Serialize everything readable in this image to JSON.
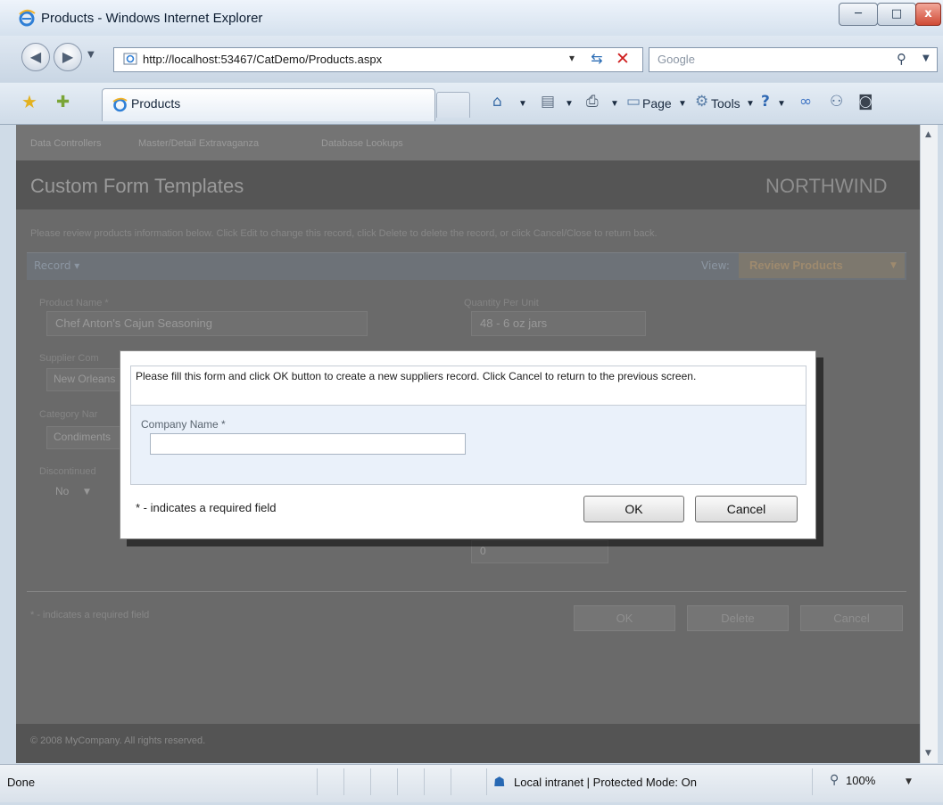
{
  "window": {
    "title": "Products - Windows Internet Explorer",
    "min": "─",
    "max": "□",
    "close": "x"
  },
  "nav": {
    "url": "http://localhost:53467/CatDemo/Products.aspx",
    "search_placeholder": "Google"
  },
  "tab": {
    "label": "Products"
  },
  "commands": {
    "page": "Page",
    "tools": "Tools"
  },
  "page": {
    "menu": [
      "Data Controllers",
      "Master/Detail Extravaganza",
      "Database Lookups"
    ],
    "title": "Custom Form Templates",
    "brand": "NORTHWIND",
    "instructions": "Please review products information below. Click Edit to change this record, click Delete to delete the record, or click Cancel/Close to return back.",
    "record_menu": "Record",
    "view_label": "View:",
    "view_value": "Review Products",
    "fields": {
      "product_name": {
        "label": "Product Name *",
        "value": "Chef Anton's Cajun Seasoning"
      },
      "quantity_per_unit": {
        "label": "Quantity Per Unit",
        "value": "48 - 6 oz jars"
      },
      "supplier": {
        "label": "Supplier Com",
        "value": "New Orleans"
      },
      "category": {
        "label": "Category Nar",
        "value": "Condiments"
      },
      "discontinued": {
        "label": "Discontinued",
        "value": "No"
      },
      "units_on_order": {
        "value": "0"
      }
    },
    "required_note": "* - indicates a required field",
    "buttons": {
      "ok": "OK",
      "delete": "Delete",
      "cancel": "Cancel"
    },
    "copyright": "© 2008 MyCompany. All rights reserved."
  },
  "dialog": {
    "instructions": "Please fill this form and click OK button to create a new suppliers record. Click Cancel to return to the previous screen.",
    "company_label": "Company Name *",
    "company_value": "",
    "required_note": "* - indicates a required field",
    "ok": "OK",
    "cancel": "Cancel"
  },
  "status": {
    "text": "Done",
    "zone": "Local intranet | Protected Mode: On",
    "zoom": "100%"
  }
}
